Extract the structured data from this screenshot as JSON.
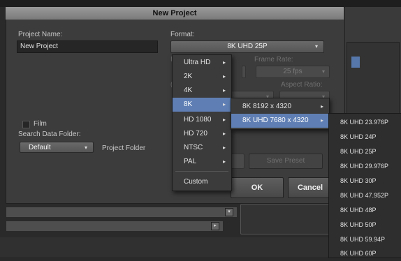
{
  "dialog": {
    "title": "New Project",
    "project_name_label": "Project Name:",
    "project_name_value": "New Project",
    "format_label": "Format:",
    "format_value": "8K UHD 25P",
    "frame_rate_label": "Frame Rate:",
    "frame_rate_value": "25 fps",
    "aspect_ratio_label": "Aspect Ratio:",
    "film_label": "Film",
    "search_data_folder_label": "Search Data Folder:",
    "search_data_folder_value": "Default",
    "project_folder_label": "Project Folder",
    "save_preset_label": "Save Preset",
    "ok_label": "OK",
    "cancel_label": "Cancel"
  },
  "format_menu": {
    "items": [
      {
        "label": "Ultra HD",
        "has_submenu": true
      },
      {
        "label": "2K",
        "has_submenu": true
      },
      {
        "label": "4K",
        "has_submenu": true
      },
      {
        "label": "8K",
        "has_submenu": true,
        "selected": true
      },
      {
        "label": "HD 1080",
        "has_submenu": true
      },
      {
        "label": "HD 720",
        "has_submenu": true
      },
      {
        "label": "NTSC",
        "has_submenu": true
      },
      {
        "label": "PAL",
        "has_submenu": true
      },
      {
        "label": "Custom",
        "has_submenu": false
      }
    ],
    "submenu_arrow": "▸"
  },
  "submenu_8k": {
    "items": [
      {
        "label": "8K 8192 x 4320",
        "selected": false
      },
      {
        "label": "8K UHD 7680 x 4320",
        "selected": true
      }
    ]
  },
  "submenu_uhd": {
    "items": [
      "8K UHD 23.976P",
      "8K UHD 24P",
      "8K UHD 25P",
      "8K UHD 29.976P",
      "8K UHD 30P",
      "8K UHD 47.952P",
      "8K UHD 48P",
      "8K UHD 50P",
      "8K UHD 59.94P",
      "8K UHD 60P"
    ]
  },
  "icons": {
    "dropdown_arrow": "▾",
    "scroll_down": "▾",
    "scroll_right": "▸"
  },
  "colors": {
    "selection": "#5f7fb4",
    "titlebar": "#8a8a8a"
  }
}
